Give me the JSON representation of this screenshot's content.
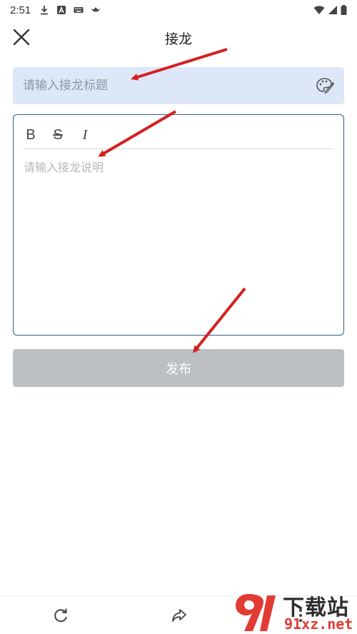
{
  "status_bar": {
    "time": "2:51"
  },
  "header": {
    "title": "接龙",
    "close_icon": "close-icon"
  },
  "form": {
    "title_placeholder": "请输入接龙标题",
    "title_value": "",
    "palette_icon": "palette-icon",
    "toolbar": {
      "bold_label": "B",
      "strike_label": "S",
      "italic_label": "I"
    },
    "description_placeholder": "请输入接龙说明",
    "description_value": "",
    "publish_label": "发布"
  },
  "bottom_bar": {
    "icons": [
      "refresh-icon",
      "share-icon",
      "more-icon"
    ]
  },
  "watermark": {
    "text": "下载站",
    "domain": "91xz.net"
  },
  "colors": {
    "title_box_bg": "#dde7f7",
    "editor_border": "#2f5f8f",
    "publish_disabled_bg": "#bcbfc4",
    "annotation_arrow": "#d42020",
    "watermark_red": "#e23b34"
  }
}
